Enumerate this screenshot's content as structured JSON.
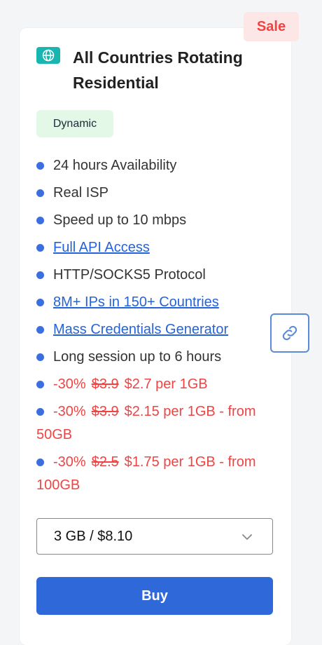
{
  "badge": {
    "sale": "Sale"
  },
  "product": {
    "icon": "globe-icon",
    "title": "All Countries Rotating Residential",
    "tag": "Dynamic"
  },
  "features": [
    {
      "text": "24 hours Availability",
      "link": false
    },
    {
      "text": "Real ISP",
      "link": false
    },
    {
      "text": "Speed up to 10 mbps",
      "link": false
    },
    {
      "text": "Full API Access",
      "link": true
    },
    {
      "text": "HTTP/SOCKS5 Protocol",
      "link": false
    },
    {
      "text": "8M+ IPs in 150+ Countries",
      "link": true
    },
    {
      "text": "Mass Credentials Generator",
      "link": true
    },
    {
      "text": "Long session up to 6 hours",
      "link": false
    }
  ],
  "prices": [
    {
      "discount": "-30%",
      "old": "$3.9",
      "new": "$2.7 per 1GB"
    },
    {
      "discount": "-30%",
      "old": "$3.9",
      "new": "$2.15 per 1GB - from 50GB"
    },
    {
      "discount": "-30%",
      "old": "$2.5",
      "new": "$1.75 per 1GB - from 100GB"
    }
  ],
  "select": {
    "value": "3 GB / $8.10"
  },
  "buy": {
    "label": "Buy"
  },
  "colors": {
    "accent": "#2f68d8",
    "sale": "#ef4444",
    "tag_bg": "#e4f8e8",
    "icon_bg": "#19b5b0"
  },
  "icons": {
    "float": "link-icon",
    "dropdown": "chevron-down-icon"
  }
}
